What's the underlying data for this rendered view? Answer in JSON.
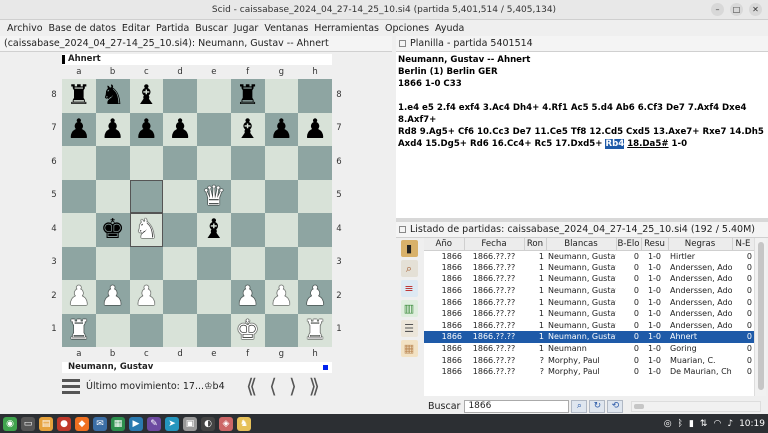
{
  "window": {
    "title": "Scid - caissabase_2024_04_27-14_25_10.si4 (partida 5,401,514 / 5,405,134)"
  },
  "menu": [
    "Archivo",
    "Base de datos",
    "Editar",
    "Partida",
    "Buscar",
    "Jugar",
    "Ventanas",
    "Herramientas",
    "Opciones",
    "Ayuda"
  ],
  "board_panel": {
    "header": "(caissabase_2024_04_27-14_25_10.si4): Neumann, Gustav -- Ahnert",
    "top_player": "Ahnert",
    "bottom_player": "Neumann, Gustav",
    "files": [
      "a",
      "b",
      "c",
      "d",
      "e",
      "f",
      "g",
      "h"
    ],
    "ranks": [
      "8",
      "7",
      "6",
      "5",
      "4",
      "3",
      "2",
      "1"
    ],
    "position": [
      [
        "bR",
        "bN",
        "bB",
        "",
        "",
        "bR",
        "",
        ""
      ],
      [
        "bP",
        "bP",
        "bP",
        "bP",
        "",
        "bB",
        "bP",
        "bP"
      ],
      [
        "",
        "",
        "",
        "",
        "",
        "",
        "",
        ""
      ],
      [
        "",
        "",
        "",
        "",
        "wQ",
        "",
        "",
        ""
      ],
      [
        "",
        "bK",
        "wN",
        "",
        "bB",
        "",
        "",
        ""
      ],
      [
        "",
        "",
        "",
        "",
        "",
        "",
        "",
        ""
      ],
      [
        "wP",
        "wP",
        "wP",
        "",
        "",
        "wP",
        "wP",
        "wP"
      ],
      [
        "wR",
        "",
        "",
        "",
        "",
        "wK",
        "",
        "wR"
      ]
    ],
    "highlight_squares": [
      "c5",
      "c4"
    ],
    "last_move": "Último movimiento: 17...♔b4",
    "nav": [
      "⟪",
      "⟨",
      "⟩",
      "⟫"
    ]
  },
  "pgn_panel": {
    "header": "Planilla - partida 5401514",
    "header_line1": "Neumann, Gustav  --  Ahnert",
    "header_line2": "Berlin (1)  Berlin GER",
    "header_line3": "1866  1-0  C33",
    "moves_a": "1.e4 e5 2.f4 exf4 3.Ac4 Dh4+ 4.Rf1 Ac5 5.d4 Ab6 6.Cf3 De7 7.Axf4 Dxe4 8.Axf7+",
    "moves_b": "Rd8 9.Ag5+ Cf6 10.Cc3 De7 11.Ce5 Tf8 12.Cd5 Cxd5 13.Axe7+ Rxe7 14.Dh5",
    "moves_c_pre": "Axd4 15.Dg5+ Rd6 16.Cc4+ Rc5 17.Dxd5+ ",
    "moves_c_cur": "Rb4",
    "moves_c_mid": " ",
    "moves_c_ul": "18.Da5#",
    "moves_c_post": " 1-0"
  },
  "list_panel": {
    "header": "Listado de partidas: caissabase_2024_04_27-14_25_10.si4 (192 / 5.40M)",
    "columns": [
      "Año",
      "Fecha",
      "Ron",
      "Blancas",
      "B-Elo",
      "Resu",
      "Negras",
      "N-E"
    ],
    "rows": [
      [
        "1866",
        "1866.??.??",
        "1",
        "Neumann, Gustav",
        "0",
        "1-0",
        "Hirtler",
        "0"
      ],
      [
        "1866",
        "1866.??.??",
        "1",
        "Neumann, Gustav",
        "0",
        "1-0",
        "Anderssen, Adolf",
        "0"
      ],
      [
        "1866",
        "1866.??.??",
        "1",
        "Neumann, Gustav",
        "0",
        "1-0",
        "Anderssen, Adolf",
        "0"
      ],
      [
        "1866",
        "1866.??.??",
        "1",
        "Neumann, Gustav",
        "0",
        "1-0",
        "Anderssen, Adolf",
        "0"
      ],
      [
        "1866",
        "1866.??.??",
        "1",
        "Neumann, Gustav",
        "0",
        "1-0",
        "Anderssen, Adolf",
        "0"
      ],
      [
        "1866",
        "1866.??.??",
        "1",
        "Neumann, Gustav",
        "0",
        "1-0",
        "Anderssen, Adolf",
        "0"
      ],
      [
        "1866",
        "1866.??.??",
        "1",
        "Neumann, Gustav",
        "0",
        "1-0",
        "Anderssen, Adolf",
        "0"
      ],
      [
        "1866",
        "1866.??.??",
        "1",
        "Neumann, Gustav",
        "0",
        "1-0",
        "Ahnert",
        "0"
      ],
      [
        "1866",
        "1866.??.??",
        "1",
        "Neumann",
        "0",
        "1-0",
        "Goring",
        "0"
      ],
      [
        "1866",
        "1866.??.??",
        "?",
        "Morphy, Paul",
        "0",
        "1-0",
        "Muarian, C.",
        "0"
      ],
      [
        "1866",
        "1866.??.??",
        "?",
        "Morphy, Paul",
        "0",
        "1-0",
        "De Maurian, Charle",
        "0"
      ]
    ],
    "selected_index": 7,
    "search_label": "Buscar",
    "search_value": "1866"
  },
  "taskbar": {
    "time": "10:19"
  },
  "colors": {
    "light_square": "#d8e2d8",
    "dark_square": "#8ea5a2",
    "selection": "#1e5aa8"
  }
}
